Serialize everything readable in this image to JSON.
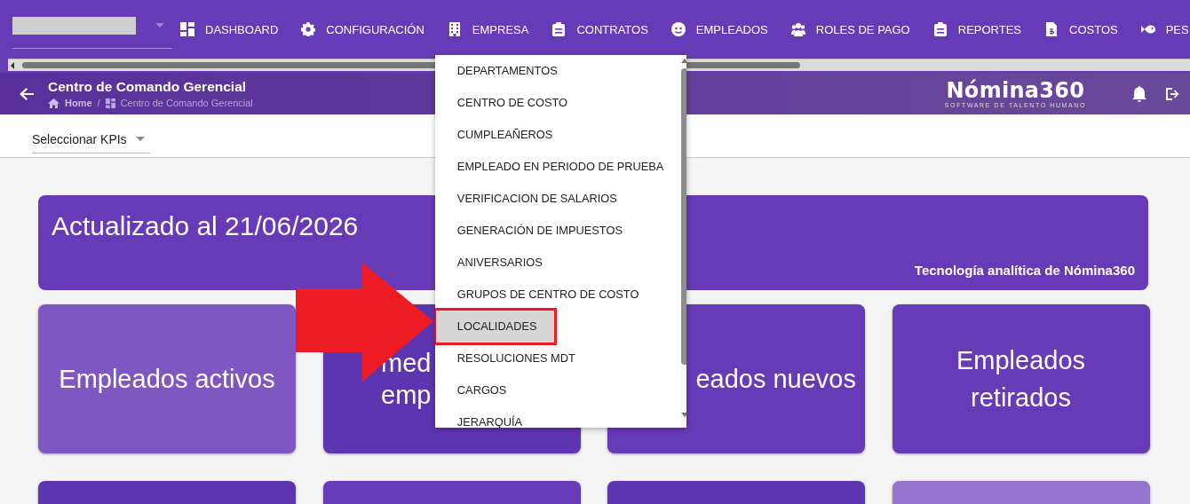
{
  "nav": {
    "items": [
      {
        "label": "DASHBOARD"
      },
      {
        "label": "CONFIGURACIÓN"
      },
      {
        "label": "EMPRESA",
        "menu": {
          "items": [
            {
              "label": "DEPARTAMENTOS",
              "selected": false
            },
            {
              "label": "CENTRO DE COSTO",
              "selected": false
            },
            {
              "label": "CUMPLEAÑEROS",
              "selected": false
            },
            {
              "label": "EMPLEADO EN PERIODO DE PRUEBA",
              "selected": false
            },
            {
              "label": "VERIFICACION DE SALARIOS",
              "selected": false
            },
            {
              "label": "GENERACIÓN DE IMPUESTOS",
              "selected": false
            },
            {
              "label": "ANIVERSARIOS",
              "selected": false
            },
            {
              "label": "GRUPOS DE CENTRO DE COSTO",
              "selected": false
            },
            {
              "label": "LOCALIDADES",
              "selected": true
            },
            {
              "label": "RESOLUCIONES MDT",
              "selected": false
            },
            {
              "label": "CARGOS",
              "selected": false
            },
            {
              "label": "JERARQUÍA",
              "selected": false
            }
          ]
        }
      },
      {
        "label": "CONTRATOS"
      },
      {
        "label": "EMPLEADOS"
      },
      {
        "label": "ROLES DE PAGO"
      },
      {
        "label": "REPORTES"
      },
      {
        "label": "COSTOS"
      },
      {
        "label": "PES"
      }
    ]
  },
  "header": {
    "title": "Centro de Comando Gerencial",
    "breadcrumb": {
      "items": [
        "Home",
        "Centro de Comando Gerencial"
      ],
      "separator": "/"
    },
    "logo": "Nómina360",
    "tagline": "SOFTWARE DE TALENTO HUMANO"
  },
  "kpi_select": {
    "placeholder": "Seleccionar KPIs"
  },
  "banner": {
    "title": "Actualizado al 21/06/2026",
    "caption": "Tecnología analítica de Nómina360"
  },
  "cards": [
    {
      "lines": [
        "Empleados activos"
      ],
      "color": "#7e57c2"
    },
    {
      "lines": [
        "med",
        "emp"
      ],
      "color": "#5e35b1"
    },
    {
      "lines": [
        "eados nuevos"
      ],
      "color": "#673ab7"
    },
    {
      "lines": [
        "Empleados",
        "retirados"
      ],
      "color": "#673ab7"
    },
    {
      "color": "#5e35b1"
    },
    {
      "color": "#673ab7"
    },
    {
      "color": "#5e35b1"
    },
    {
      "color": "#9575cd"
    }
  ]
}
